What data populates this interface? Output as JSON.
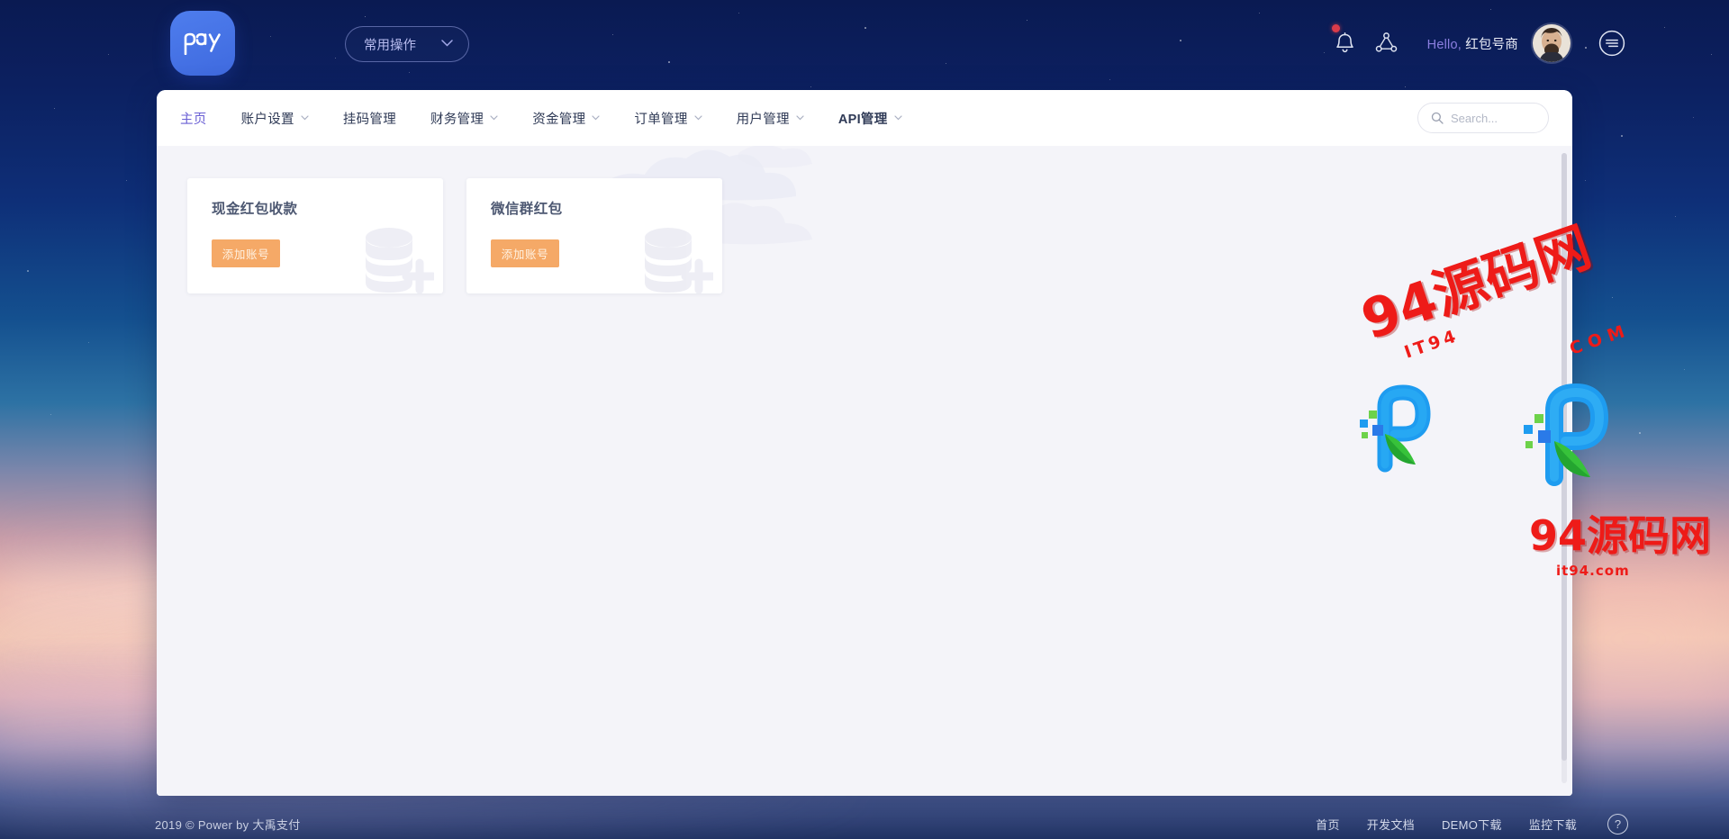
{
  "brand": {
    "logo_text": "pay"
  },
  "topbar": {
    "quick_ops_label": "常用操作",
    "quick_ops_chevron": "chevron-down-icon",
    "notification_icon": "bell-icon",
    "share_icon": "share-network-icon",
    "greeting_prefix": "Hello,",
    "user_name": "红包号商",
    "avatar": "user-avatar",
    "menu_icon": "hamburger-circle-icon"
  },
  "nav": {
    "items": [
      {
        "label": "主页",
        "has_caret": false,
        "active": true
      },
      {
        "label": "账户设置",
        "has_caret": true,
        "active": false
      },
      {
        "label": "挂码管理",
        "has_caret": false,
        "active": false
      },
      {
        "label": "财务管理",
        "has_caret": true,
        "active": false
      },
      {
        "label": "资金管理",
        "has_caret": true,
        "active": false
      },
      {
        "label": "订单管理",
        "has_caret": true,
        "active": false
      },
      {
        "label": "用户管理",
        "has_caret": true,
        "active": false
      },
      {
        "label": "API管理",
        "has_caret": true,
        "active": false
      }
    ]
  },
  "search": {
    "placeholder": "Search...",
    "value": "",
    "icon": "search-icon"
  },
  "cards": [
    {
      "title": "现金红包收款",
      "button_label": "添加账号",
      "watermark_icon": "database-add-icon"
    },
    {
      "title": "微信群红包",
      "button_label": "添加账号",
      "watermark_icon": "database-add-icon"
    }
  ],
  "footer": {
    "copyright": "2019 © Power by 大禹支付",
    "links": [
      {
        "label": "首页"
      },
      {
        "label": "开发文档"
      },
      {
        "label": "DEMO下载"
      },
      {
        "label": "监控下载"
      }
    ],
    "help_icon_label": "?"
  },
  "watermarks": [
    {
      "main": "94源码网",
      "sub": "IT94",
      "tld": "COM"
    },
    {
      "main": "94源码网",
      "sub": "it94.com"
    }
  ],
  "colors": {
    "accent_purple": "#6a5fd4",
    "brand_blue": "#4e7ded",
    "button_orange": "#f5a967",
    "watermark_red": "#ee1b18",
    "notification_red": "#d93b4a"
  }
}
